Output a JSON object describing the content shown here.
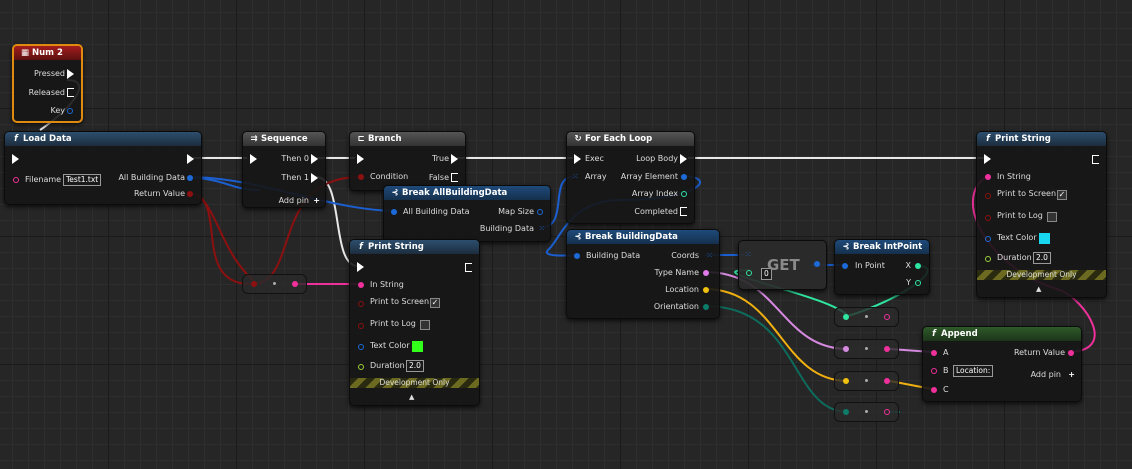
{
  "colors": {
    "exec": "#ffffff",
    "string": "#f0309b",
    "struct": "#1b6ad8",
    "bool": "#8c1010",
    "int": "#2fe6a0",
    "struct_teal": "#0e7c6b",
    "vector": "#f0c010",
    "text": "#e07ae8",
    "linear_color": "#1e6bd8",
    "float": "#9ed13a"
  },
  "nodes": {
    "num2": {
      "title": "Num 2",
      "pressed": "Pressed",
      "released": "Released",
      "key": "Key",
      "icon": "keyboard-icon"
    },
    "load_data": {
      "title": "Load Data",
      "filename_label": "Filename",
      "filename_value": "Test1.txt",
      "all_building_data": "All Building Data",
      "return_value": "Return Value"
    },
    "sequence": {
      "title": "Sequence",
      "then0": "Then 0",
      "then1": "Then 1",
      "add_pin": "Add pin"
    },
    "branch": {
      "title": "Branch",
      "true": "True",
      "condition": "Condition",
      "false": "False"
    },
    "break_all": {
      "title": "Break AllBuildingData",
      "input": "All Building Data",
      "map_size": "Map Size",
      "building_data": "Building Data"
    },
    "foreach": {
      "title": "For Each Loop",
      "exec": "Exec",
      "loop_body": "Loop Body",
      "array": "Array",
      "array_element": "Array Element",
      "array_index": "Array Index",
      "completed": "Completed"
    },
    "print1": {
      "title": "Print String",
      "in_string": "In String",
      "print_to_screen": "Print to Screen",
      "print_to_log": "Print to Log",
      "text_color": "Text Color",
      "duration": "Duration",
      "duration_value": "2.0",
      "dev_only": "Development Only",
      "text_color_value": "#32ff1a"
    },
    "print2": {
      "title": "Print String",
      "in_string": "In String",
      "print_to_screen": "Print to Screen",
      "print_to_log": "Print to Log",
      "text_color": "Text Color",
      "duration": "Duration",
      "duration_value": "2.0",
      "dev_only": "Development Only",
      "text_color_value": "#18d6f0"
    },
    "break_building": {
      "title": "Break BuildingData",
      "input": "Building Data",
      "coords": "Coords",
      "type_name": "Type Name",
      "location": "Location",
      "orientation": "Orientation"
    },
    "get": {
      "title": "GET",
      "index_value": "0"
    },
    "break_intpoint": {
      "title": "Break IntPoint",
      "in_point": "In Point",
      "x": "X",
      "y": "Y"
    },
    "append": {
      "title": "Append",
      "a": "A",
      "b": "B",
      "b_value": "Location:",
      "c": "C",
      "return_value": "Return Value",
      "add_pin": "Add pin"
    }
  }
}
